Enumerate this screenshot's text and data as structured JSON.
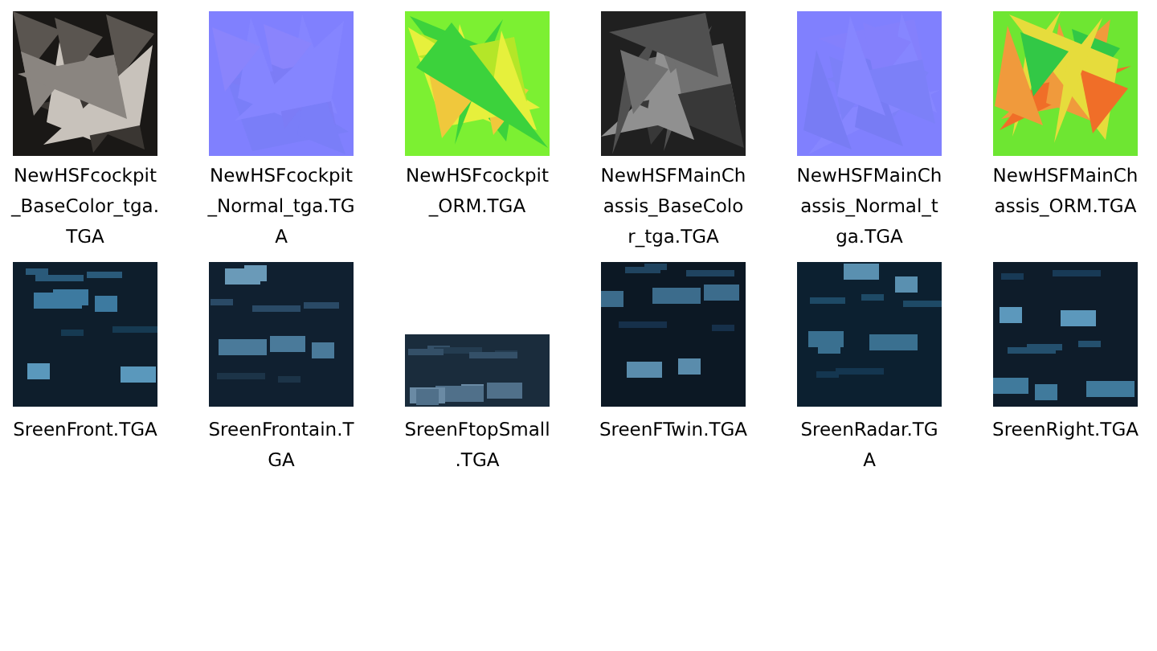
{
  "files": [
    {
      "name_lines": [
        "NewHSFcockpit",
        "_BaseColor_tga.",
        "TGA"
      ],
      "thumbnail": {
        "kind": "picture"
      }
    },
    {
      "name_lines": [
        "NewHSFcockpit",
        "_Normal_tga.TG",
        "A"
      ],
      "thumbnail": {
        "kind": "picture"
      }
    },
    {
      "name_lines": [
        "NewHSFcockpit",
        "_ORM.TGA"
      ],
      "thumbnail": {
        "kind": "picture"
      }
    },
    {
      "name_lines": [
        "NewHSFMainCh",
        "assis_BaseColo",
        "r_tga.TGA"
      ],
      "thumbnail": {
        "kind": "picture"
      }
    },
    {
      "name_lines": [
        "NewHSFMainCh",
        "assis_Normal_t",
        "ga.TGA"
      ],
      "thumbnail": {
        "kind": "picture"
      }
    },
    {
      "name_lines": [
        "NewHSFMainCh",
        "assis_ORM.TGA"
      ],
      "thumbnail": {
        "kind": "picture"
      }
    },
    {
      "name_lines": [
        "SreenFront.TGA"
      ],
      "thumbnail": {
        "kind": "picture"
      }
    },
    {
      "name_lines": [
        "SreenFrontain.T",
        "GA"
      ],
      "thumbnail": {
        "kind": "picture"
      }
    },
    {
      "name_lines": [
        "SreenFtopSmall",
        ".TGA"
      ],
      "thumbnail": {
        "kind": "wide-picture"
      }
    },
    {
      "name_lines": [
        "SreenFTwin.TGA"
      ],
      "thumbnail": {
        "kind": "picture"
      }
    },
    {
      "name_lines": [
        "SreenRadar.TG",
        "A"
      ],
      "thumbnail": {
        "kind": "picture"
      }
    },
    {
      "name_lines": [
        "SreenRight.TGA"
      ],
      "thumbnail": {
        "kind": "picture"
      }
    }
  ]
}
